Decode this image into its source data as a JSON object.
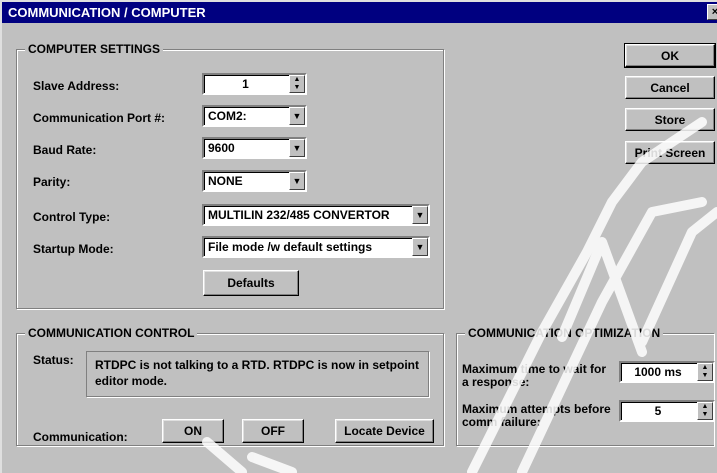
{
  "window": {
    "title": "COMMUNICATION  /  COMPUTER",
    "close_glyph": "×"
  },
  "computer_settings": {
    "title": "COMPUTER SETTINGS",
    "slave_address": {
      "label": "Slave Address:",
      "value": "1"
    },
    "comm_port": {
      "label": "Communication Port #:",
      "value": "COM2:"
    },
    "baud_rate": {
      "label": "Baud Rate:",
      "value": "9600"
    },
    "parity": {
      "label": "Parity:",
      "value": "NONE"
    },
    "control_type": {
      "label": "Control Type:",
      "value": "MULTILIN 232/485 CONVERTOR"
    },
    "startup_mode": {
      "label": "Startup Mode:",
      "value": "File mode /w default settings"
    },
    "defaults_label": "Defaults"
  },
  "buttons": {
    "ok": "OK",
    "cancel": "Cancel",
    "store": "Store",
    "print_screen": "Print Screen"
  },
  "communication_control": {
    "title": "COMMUNICATION CONTROL",
    "status_label": "Status:",
    "status_text": "RTDPC is not talking to a RTD.  RTDPC is now in setpoint editor mode.",
    "communication_label": "Communication:",
    "on_label": "ON",
    "off_label": "OFF",
    "locate_label": "Locate Device"
  },
  "communication_optimization": {
    "title": "COMMUNICATION OPTIMIZATION",
    "max_wait": {
      "label": "Maximum time to wait for a response:",
      "value": "1000 ms"
    },
    "max_attempts": {
      "label": "Maximum attempts before comm failure:",
      "value": "5"
    }
  }
}
